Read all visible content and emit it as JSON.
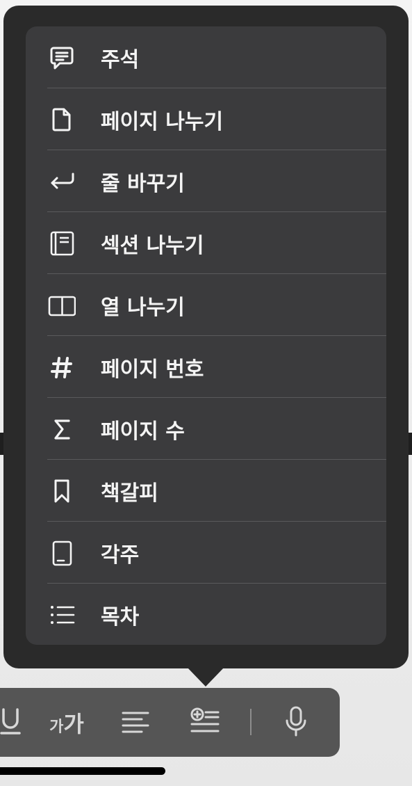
{
  "menu": {
    "items": [
      {
        "label": "주석",
        "icon": "comment-icon"
      },
      {
        "label": "페이지 나누기",
        "icon": "page-icon"
      },
      {
        "label": "줄 바꾸기",
        "icon": "return-arrow-icon"
      },
      {
        "label": "섹션 나누기",
        "icon": "section-icon"
      },
      {
        "label": "열 나누기",
        "icon": "columns-icon"
      },
      {
        "label": "페이지 번호",
        "icon": "hash-icon"
      },
      {
        "label": "페이지 수",
        "icon": "sigma-icon"
      },
      {
        "label": "책갈피",
        "icon": "bookmark-icon"
      },
      {
        "label": "각주",
        "icon": "footnote-icon"
      },
      {
        "label": "목차",
        "icon": "list-icon"
      }
    ]
  },
  "toolbar": {
    "font_size_small": "가",
    "font_size_large": "가",
    "items": [
      "underline-icon",
      "font-size-icon",
      "align-left-icon",
      "insert-icon",
      "microphone-icon"
    ]
  },
  "colors": {
    "popover_bg": "#2a2a2a",
    "menu_bg": "#3b3b3d",
    "text": "#f4f4f4",
    "toolbar_bg": "#555555"
  }
}
